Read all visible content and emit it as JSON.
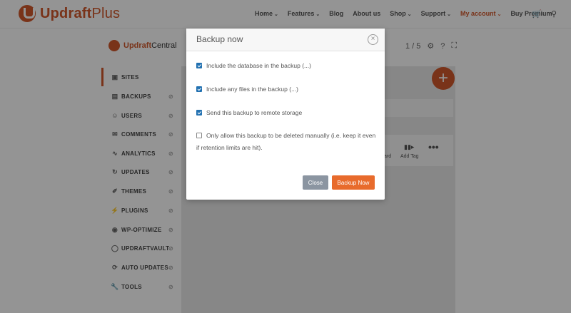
{
  "header": {
    "brand": {
      "main": "Updraft",
      "light": "Plus"
    },
    "nav": [
      {
        "label": "Home",
        "dropdown": true
      },
      {
        "label": "Features",
        "dropdown": true
      },
      {
        "label": "Blog",
        "dropdown": false
      },
      {
        "label": "About us",
        "dropdown": false
      },
      {
        "label": "Shop",
        "dropdown": true
      },
      {
        "label": "Support",
        "dropdown": true
      },
      {
        "label": "My account",
        "dropdown": true,
        "active": true
      },
      {
        "label": "Buy Premium",
        "dropdown": false
      }
    ],
    "icons": {
      "cart": "cart-icon",
      "search": "search-icon"
    }
  },
  "central": {
    "brand": {
      "main": "Updraft",
      "light": "Central"
    },
    "pagination": "1 / 5",
    "icons": [
      "gear-icon",
      "help-icon",
      "fullscreen-icon"
    ]
  },
  "sidebar": {
    "items": [
      {
        "label": "SITES",
        "icon": "monitor-icon",
        "active": true
      },
      {
        "label": "BACKUPS",
        "icon": "backup-icon"
      },
      {
        "label": "USERS",
        "icon": "user-icon"
      },
      {
        "label": "COMMENTS",
        "icon": "comment-icon"
      },
      {
        "label": "ANALYTICS",
        "icon": "analytics-icon"
      },
      {
        "label": "UPDATES",
        "icon": "refresh-icon"
      },
      {
        "label": "THEMES",
        "icon": "brush-icon"
      },
      {
        "label": "PLUGINS",
        "icon": "plug-icon"
      },
      {
        "label": "WP-OPTIMIZE",
        "icon": "optimize-icon"
      },
      {
        "label": "UPDRAFTVAULT",
        "icon": "vault-icon"
      },
      {
        "label": "AUTO UPDATES",
        "icon": "auto-update-icon"
      },
      {
        "label": "TOOLS",
        "icon": "wrench-icon"
      }
    ]
  },
  "background": {
    "actions": [
      "ard",
      "Add Tag"
    ]
  },
  "modal": {
    "title": "Backup now",
    "options": [
      {
        "label": "Include the database in the backup (...)",
        "checked": true
      },
      {
        "label": "Include any files in the backup (...)",
        "checked": true
      },
      {
        "label": "Send this backup to remote storage",
        "checked": true
      },
      {
        "label": "Only allow this backup to be deleted manually (i.e. keep it even if retention limits are hit).",
        "checked": false
      }
    ],
    "close_label": "Close",
    "backup_label": "Backup Now"
  }
}
